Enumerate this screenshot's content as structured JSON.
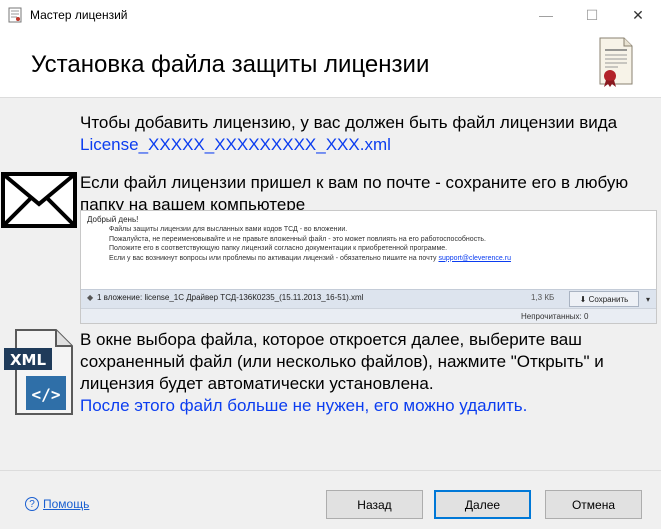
{
  "window": {
    "title": "Мастер лицензий",
    "controls": {
      "minimize": "—",
      "maximize": "☐",
      "close": "✕"
    }
  },
  "header": {
    "title": "Установка файла защиты лицензии",
    "icon": "certificate-icon"
  },
  "intro": {
    "text": "Чтобы добавить лицензию, у вас должен быть файл лицензии вида ",
    "filename": "License_XXXXX_XXXXXXXXX_XXX.xml"
  },
  "mail_step": {
    "icon": "envelope-icon",
    "text": "Если файл лицензии пришел к вам по почте - сохраните его в любую папку на вашем компьютере"
  },
  "email_preview": {
    "greeting": "Добрый день!",
    "lines": [
      "Файлы защиты лицензии для высланных вами кодов ТСД - во вложении.",
      "Пожалуйста, не переименовывайте и не правьте вложенный файл - это может повлиять на его работоспособность.",
      "Положите его в соответствующую папку лицензий согласно документации к приобретенной программе.",
      "Если у вас возникнут вопросы или проблемы по активации лицензий - обязательно пишите на почту "
    ],
    "support_email": "support@cleverence.ru",
    "attachment": "1 вложение: license_1С Драйвер ТСД-136К0235_(15.11.2013_16-51).xml",
    "size": "1,3 КБ",
    "save_label": "Сохранить",
    "status": "Непрочитанных: 0"
  },
  "open_step": {
    "icon": "xml-file-icon",
    "text": "В окне выбора файла, которое откроется далее, выберите ваш сохраненный файл (или несколько файлов), нажмите \"Открыть\" и лицензия будет автоматически установлена.",
    "note": "После этого файл больше не нужен, его можно удалить."
  },
  "footer": {
    "help_label": "Помощь",
    "back_label": "Назад",
    "next_label": "Далее",
    "cancel_label": "Отмена"
  },
  "colors": {
    "accent": "#0078d7",
    "link_blue": "#0b3df0",
    "panel_bg": "#f0f0f0"
  }
}
